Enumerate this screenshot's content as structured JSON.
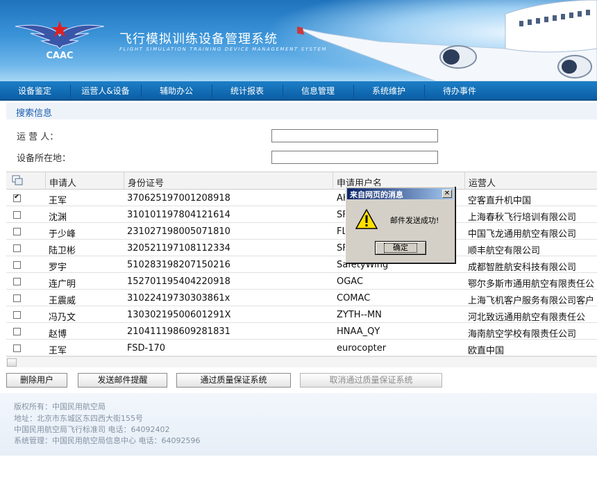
{
  "header": {
    "logo_text": "CAAC",
    "title": "飞行模拟训练设备管理系统",
    "subtitle": "FLIGHT SIMULATION TRAINING DEVICE MANAGEMENT SYSTEM"
  },
  "nav": {
    "items": [
      {
        "label": "设备鉴定"
      },
      {
        "label": "运营人&设备"
      },
      {
        "label": "辅助办公"
      },
      {
        "label": "统计报表"
      },
      {
        "label": "信息管理"
      },
      {
        "label": "系统维护"
      },
      {
        "label": "待办事件"
      }
    ]
  },
  "search": {
    "title": "搜索信息",
    "operator_label": "运 营 人：",
    "operator_value": "",
    "location_label": "设备所在地：",
    "location_value": ""
  },
  "table": {
    "columns": [
      "申请人",
      "身份证号",
      "申请用户名",
      "运营人"
    ],
    "rows": [
      {
        "checked": true,
        "name": "王军",
        "id": "370625197001208918",
        "username": "AH",
        "operator": "空客直升机中国"
      },
      {
        "checked": false,
        "name": "沈渊",
        "id": "310101197804121614",
        "username": "SF",
        "operator": "上海春秋飞行培训有限公司"
      },
      {
        "checked": false,
        "name": "于少峰",
        "id": "231027198005071810",
        "username": "FL",
        "operator": "中国飞龙通用航空有限公司"
      },
      {
        "checked": false,
        "name": "陆卫彬",
        "id": "320521197108112334",
        "username": "SF",
        "operator": "顺丰航空有限公司"
      },
      {
        "checked": false,
        "name": "罗宇",
        "id": "510283198207150216",
        "username": "SafetyWing",
        "operator": "成都智胜航安科技有限公司"
      },
      {
        "checked": false,
        "name": "连广明",
        "id": "152701195404220918",
        "username": "OGAC",
        "operator": "鄂尔多斯市通用航空有限责任公"
      },
      {
        "checked": false,
        "name": "王震威",
        "id": "310224197303038​61x",
        "username": "COMAC",
        "operator": "上海飞机客户服务有限公司客户"
      },
      {
        "checked": false,
        "name": "冯乃文",
        "id": "130302195006012​91X",
        "username": "ZYTH--MN",
        "operator": "河北致远通用航空有限责任公"
      },
      {
        "checked": false,
        "name": "赵博",
        "id": "210411198609281831",
        "username": "HNAA_QY",
        "operator": "海南航空学校有限责任公司"
      },
      {
        "checked": false,
        "name": "王军",
        "id": "FSD-170",
        "username": "eurocopter",
        "operator": "欧直中国"
      }
    ]
  },
  "buttons": {
    "delete_user": "删除用户",
    "send_email": "发送邮件提醒",
    "pass_qa": "通过质量保证系统",
    "cancel_qa": "取消通过质量保证系统"
  },
  "footer": {
    "copyright": "版权所有：中国民用航空局",
    "address": "地址：北京市东城区东四西大街155号",
    "std_office": "中国民用航空局飞行标准司  电话：64092402",
    "sys_admin": "系统管理：中国民用航空局信息中心  电话：64092596"
  },
  "dialog": {
    "title": "来自网页的消息",
    "message": "邮件发送成功!",
    "ok_label": "确定",
    "close_glyph": "✕"
  },
  "colors": {
    "nav_bg": "#0a5ea6",
    "accent_text": "#1a5fb0",
    "dialog_title": "#0a246a"
  }
}
